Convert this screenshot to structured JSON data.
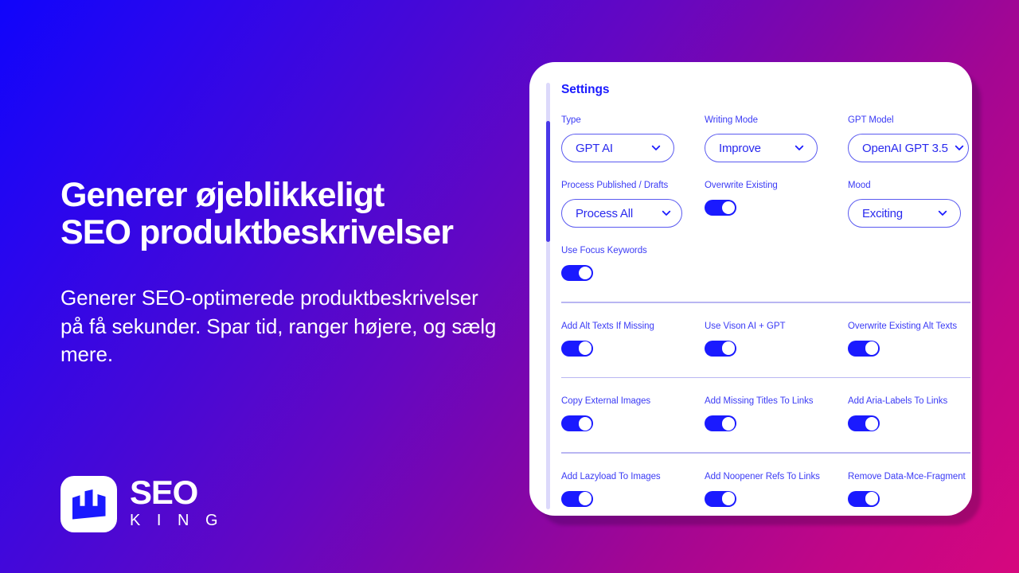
{
  "theme": {
    "bg_gradient_start": "#1005fb",
    "bg_gradient_mid": "#8206a8",
    "bg_gradient_end": "#d6077e",
    "accent_blue": "#1a1aff",
    "label_blue": "#3b3bf5",
    "card_bg": "#ffffff"
  },
  "marketing": {
    "headline_line1": "Generer øjeblikkeligt",
    "headline_line2": "SEO produktbeskrivelser",
    "subheading": "Generer SEO-optimerede produktbeskrivelser på få sekunder. Spar tid, ranger højere, og sælg mere."
  },
  "logo": {
    "name_primary": "SEO",
    "name_secondary": "K I N G",
    "mark_icon": "crown-bar-chart-icon"
  },
  "card": {
    "title": "Settings",
    "gear_icon": "gear-icon",
    "chevron_icon": "chevron-down-icon",
    "scrollbar": {
      "name": "vertical-scrollbar",
      "thumb_name": "scrollbar-thumb"
    },
    "rows": [
      {
        "type": "fields",
        "fields": [
          {
            "kind": "select",
            "label": "Type",
            "value": "GPT AI"
          },
          {
            "kind": "select",
            "label": "Writing Mode",
            "value": "Improve"
          },
          {
            "kind": "select",
            "label": "GPT Model",
            "value": "OpenAI GPT 3.5"
          }
        ]
      },
      {
        "type": "fields",
        "fields": [
          {
            "kind": "select",
            "label": "Process Published / Drafts",
            "value": "Process All"
          },
          {
            "kind": "toggle",
            "label": "Overwrite Existing",
            "value": "on"
          },
          {
            "kind": "select",
            "label": "Mood",
            "value": "Exciting"
          }
        ]
      },
      {
        "type": "fields",
        "fields": [
          {
            "kind": "toggle",
            "label": "Use Focus Keywords",
            "value": "on"
          }
        ]
      },
      {
        "type": "divider"
      },
      {
        "type": "fields",
        "fields": [
          {
            "kind": "toggle",
            "label": "Add Alt Texts If Missing",
            "value": "on"
          },
          {
            "kind": "toggle",
            "label": "Use Vison AI + GPT",
            "value": "on"
          },
          {
            "kind": "toggle",
            "label": "Overwrite Existing Alt Texts",
            "value": "on"
          }
        ]
      },
      {
        "type": "divider"
      },
      {
        "type": "fields",
        "fields": [
          {
            "kind": "toggle",
            "label": "Copy External Images",
            "value": "on"
          },
          {
            "kind": "toggle",
            "label": "Add Missing Titles To Links",
            "value": "on"
          },
          {
            "kind": "toggle",
            "label": "Add Aria-Labels To Links",
            "value": "on"
          }
        ]
      },
      {
        "type": "divider"
      },
      {
        "type": "fields",
        "fields": [
          {
            "kind": "toggle",
            "label": "Add Lazyload To Images",
            "value": "on"
          },
          {
            "kind": "toggle",
            "label": "Add Noopener Refs To Links",
            "value": "on"
          },
          {
            "kind": "toggle",
            "label": "Remove Data-Mce-Fragment",
            "value": "on"
          }
        ]
      }
    ]
  }
}
